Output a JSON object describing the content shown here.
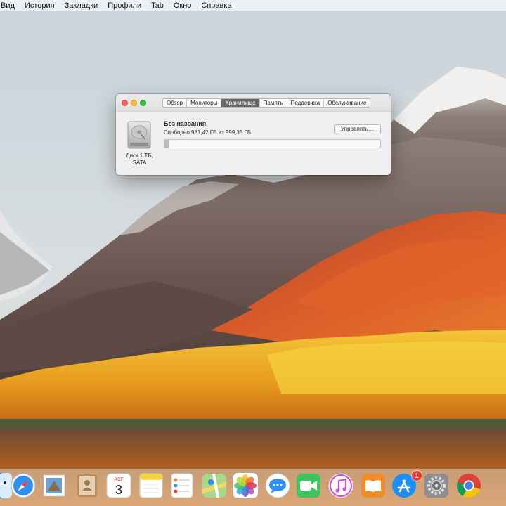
{
  "menubar": {
    "items": [
      "Вид",
      "История",
      "Закладки",
      "Профили",
      "Tab",
      "Окно",
      "Справка"
    ]
  },
  "window": {
    "tabs": [
      "Обзор",
      "Мониторы",
      "Хранилище",
      "Память",
      "Поддержка",
      "Обслуживание"
    ],
    "active_tab": "Хранилище",
    "disk": {
      "caption_line1": "Диск 1 ТБ,",
      "caption_line2": "SATA",
      "volume_name": "Без названия",
      "free_text": "Свободно 981,42 ГБ из 999,35 ГБ",
      "used_fraction": 0.018
    },
    "manage_button": "Управлять…"
  },
  "dock": {
    "icons": [
      "finder-icon",
      "safari-icon",
      "mail-icon",
      "contacts-icon",
      "calendar-icon",
      "notes-icon",
      "reminders-icon",
      "maps-icon",
      "photos-icon",
      "messages-icon",
      "facetime-icon",
      "itunes-icon",
      "ibooks-icon",
      "app-store-icon",
      "system-preferences-icon",
      "chrome-icon"
    ],
    "calendar": {
      "month": "АВГ",
      "day": "3"
    },
    "app_store_badge": "1"
  },
  "colors": {
    "active_tab": "#686868",
    "traffic_close": "#fc5f57",
    "traffic_minimize": "#fdbc2e",
    "traffic_zoom": "#28c840",
    "badge": "#f2382e"
  }
}
